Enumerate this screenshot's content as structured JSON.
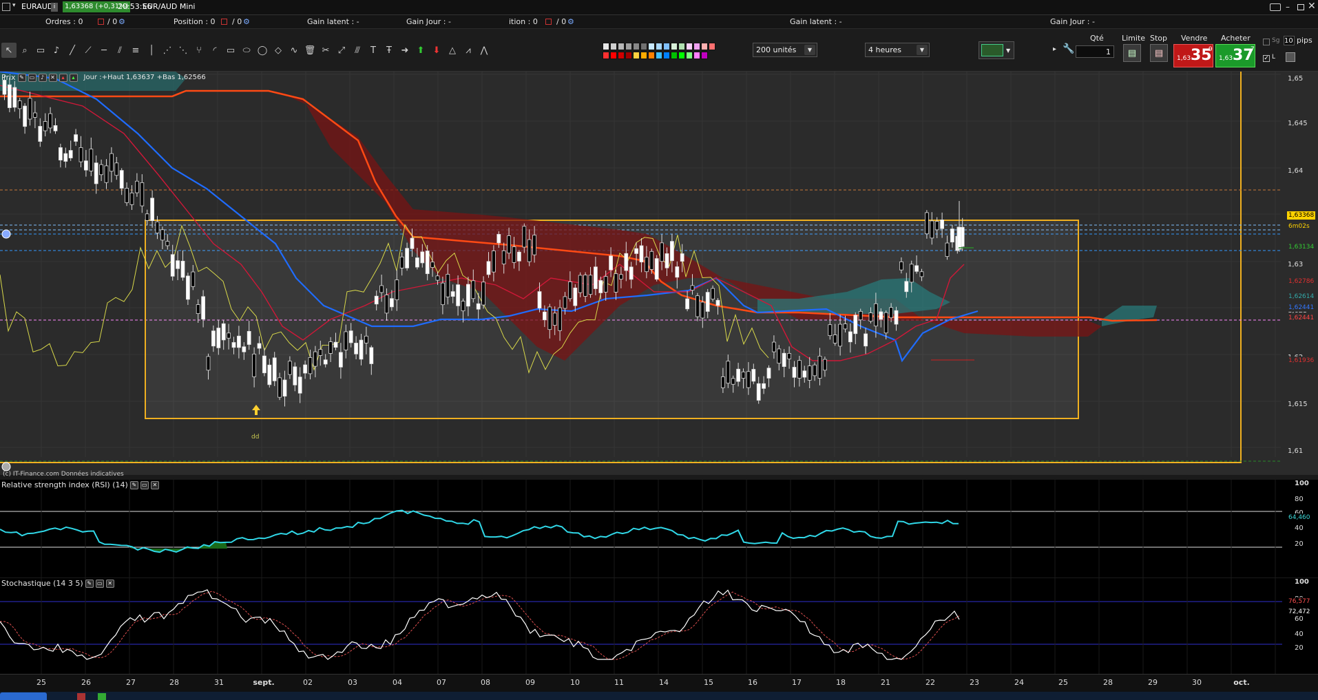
{
  "titlebar": {
    "symbol": "EURAUD",
    "price_badge": "1,63368 (+0,31%)",
    "time": "20:53:56",
    "instrument": "EUR/AUD Mini"
  },
  "infobar": {
    "orders_label": "Ordres : 0",
    "orders_count": "/ 0",
    "position_label": "Position : 0",
    "position_count": "/ 0",
    "gain_latent_1": "Gain latent : -",
    "gain_jour_1": "Gain Jour : -",
    "position2_label": "ition : 0",
    "position2_count": "/ 0",
    "gain_latent_2": "Gain latent : -",
    "gain_jour_2": "Gain Jour : -"
  },
  "toolbar": {
    "units_value": "200 unités",
    "period_value": "4 heures",
    "qty_label": "Qté",
    "qty_value": "1",
    "limit_label": "Limite",
    "stop_label": "Stop",
    "sell_label": "Vendre",
    "buy_label": "Acheter",
    "sell_small": "1,63",
    "sell_big": "35",
    "sell_sup": "9",
    "buy_small": "1,63",
    "buy_big": "37",
    "buy_sup": "7",
    "pips_value": "10",
    "pips_label": "pips",
    "sg_label": "Sg",
    "l_label": "L",
    "palette_colors": [
      "#e8e8e8",
      "#d0d0d0",
      "#b8b8b8",
      "#a0a0a0",
      "#888888",
      "#707070",
      "#c8e8ff",
      "#a8d8ff",
      "#80c0ff",
      "#d8f0d8",
      "#b0e0b0",
      "#f8d0f8",
      "#f0a0f0",
      "#ffb0b0",
      "#ff7070",
      "#ff3030",
      "#ff0000",
      "#d00000",
      "#a00000",
      "#ffd040",
      "#ffaa00",
      "#ff8000",
      "#40c0ff",
      "#0080ff",
      "#00c000",
      "#00ff00",
      "#80ff80",
      "#ff80ff",
      "#c000c0"
    ]
  },
  "price_panel": {
    "header_label": "Prix",
    "header_info": "Jour :+Haut 1,63637 +Bas 1,62566",
    "annotation_dd": "dd",
    "watermark": "(c) IT-Finance.com  Données indicatives",
    "y_ticks": [
      "1,65",
      "1,645",
      "1,64",
      "1,635",
      "1,63",
      "1,625",
      "1,62",
      "1,615",
      "1,61"
    ],
    "price_chips": [
      {
        "text": "1,63368",
        "bg": "#ffd200",
        "fg": "#000"
      },
      {
        "text": "6m02s",
        "bg": "#2b2b2b",
        "fg": "#ffd200"
      },
      {
        "text": "1,63134",
        "bg": "#2b2b2b",
        "fg": "#33cc33"
      },
      {
        "text": "1,62786",
        "bg": "#2b2b2b",
        "fg": "#e03030"
      },
      {
        "text": "1,62614",
        "bg": "#2b2b2b",
        "fg": "#33aaaa"
      },
      {
        "text": "1,62441",
        "bg": "#2b2b2b",
        "fg": "#3377ff"
      },
      {
        "text": "1,62441",
        "bg": "#2b2b2b",
        "fg": "#ff4444"
      },
      {
        "text": "1,61936",
        "bg": "#2b2b2b",
        "fg": "#e03030"
      }
    ]
  },
  "rsi_panel": {
    "title": "Relative strength index (RSI) (14)",
    "y_ticks": [
      "100",
      "80",
      "60",
      "40",
      "20"
    ],
    "value": "64,460"
  },
  "stoch_panel": {
    "title": "Stochastique (14 3 5)",
    "y_ticks": [
      "100",
      "80",
      "60",
      "40",
      "20"
    ],
    "value_1": "76,577",
    "value_2": "72,472"
  },
  "x_axis": {
    "labels": [
      "25",
      "26",
      "27",
      "28",
      "31",
      "sept.",
      "02",
      "03",
      "04",
      "07",
      "08",
      "09",
      "10",
      "11",
      "14",
      "15",
      "16",
      "17",
      "18",
      "21",
      "22",
      "23",
      "24",
      "25",
      "28",
      "29",
      "30",
      "oct."
    ]
  }
}
